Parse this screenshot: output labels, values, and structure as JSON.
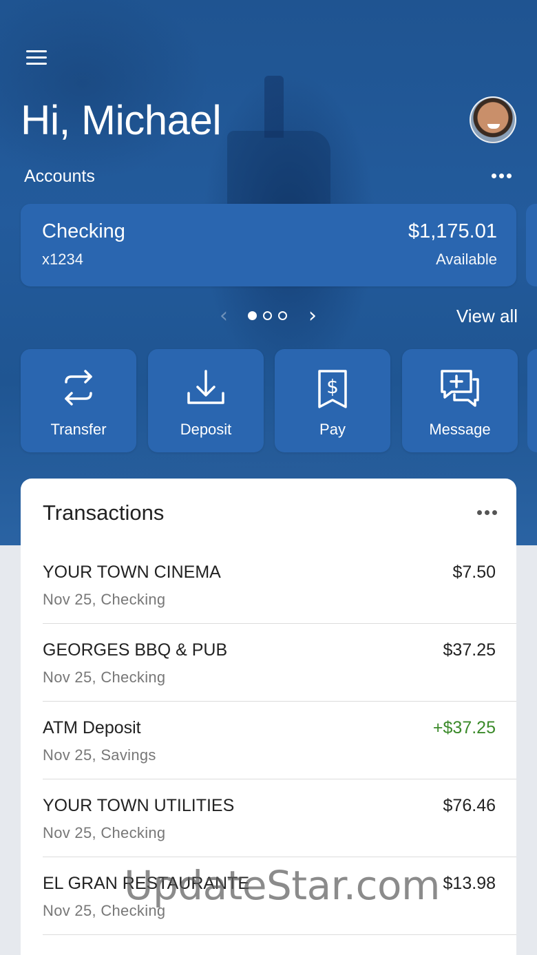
{
  "header": {
    "greeting": "Hi, Michael",
    "accounts_label": "Accounts"
  },
  "account_card": {
    "name": "Checking",
    "number": "x1234",
    "balance": "$1,175.01",
    "balance_label": "Available"
  },
  "carousel": {
    "page_count": 3,
    "current_page": 1,
    "view_all_label": "View all"
  },
  "actions": [
    {
      "label": "Transfer",
      "icon": "transfer-icon"
    },
    {
      "label": "Deposit",
      "icon": "deposit-icon"
    },
    {
      "label": "Pay",
      "icon": "pay-bill-icon"
    },
    {
      "label": "Message",
      "icon": "message-icon"
    }
  ],
  "transactions": {
    "title": "Transactions",
    "items": [
      {
        "merchant": "YOUR TOWN CINEMA",
        "meta": "Nov 25, Checking",
        "amount": "$7.50",
        "credit": false
      },
      {
        "merchant": "GEORGES BBQ & PUB",
        "meta": "Nov 25, Checking",
        "amount": "$37.25",
        "credit": false
      },
      {
        "merchant": "ATM Deposit",
        "meta": "Nov 25, Savings",
        "amount": "+$37.25",
        "credit": true
      },
      {
        "merchant": "YOUR TOWN UTILITIES",
        "meta": "Nov 25, Checking",
        "amount": "$76.46",
        "credit": false
      },
      {
        "merchant": "EL GRAN RESTAURANTE",
        "meta": "Nov 25, Checking",
        "amount": "$13.98",
        "credit": false
      }
    ]
  },
  "colors": {
    "hero_blue": "#235b9c",
    "card_blue": "#2a66b0",
    "credit_green": "#3b8a2a"
  },
  "watermark": "UpdateStar.com"
}
